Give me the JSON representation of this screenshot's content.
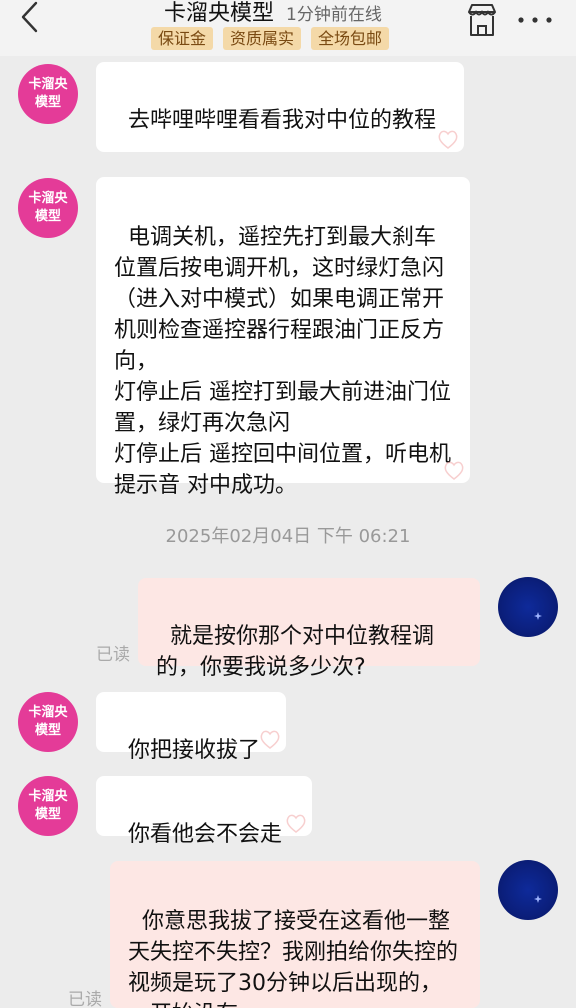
{
  "header": {
    "shop_name": "卡溜央模型",
    "online_status": "1分钟前在线",
    "badges": [
      "保证金",
      "资质属实",
      "全场包邮"
    ]
  },
  "shop_avatar": {
    "line1": "卡溜央",
    "line2": "模型",
    "color": "#e43b98"
  },
  "messages": [
    {
      "from": "shop",
      "text": "去哔哩哔哩看看我对中位的教程"
    },
    {
      "from": "shop",
      "text": "电调关机，遥控先打到最大刹车位置后按电调开机，这时绿灯急闪（进入对中模式）如果电调正常开机则检查遥控器行程跟油门正反方向，\n灯停止后 遥控打到最大前进油门位置，绿灯再次急闪\n灯停止后 遥控回中间位置，听电机提示音 对中成功。"
    },
    {
      "from": "me",
      "text": "就是按你那个对中位教程调的，你要我说多少次?",
      "status": "已读"
    },
    {
      "from": "shop",
      "text": "你把接收拔了"
    },
    {
      "from": "shop",
      "text": "你看他会不会走"
    },
    {
      "from": "me",
      "text": "你意思我拔了接受在这看他一整天失控不失控？我刚拍给你失控的视频是玩了30分钟以后出现的，一开始没有",
      "status": "已读"
    }
  ],
  "timestamp": "2025年02月04日 下午 06:21",
  "colors": {
    "incoming_bubble": "#ffffff",
    "outgoing_bubble": "#fde7e4",
    "badge_bg": "#f4d9a8",
    "badge_text": "#7a4a12"
  }
}
